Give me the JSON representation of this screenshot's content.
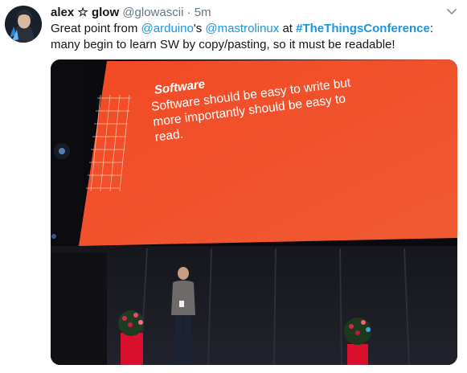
{
  "tweet": {
    "display_name": "alex ☆ glow",
    "handle": "@glowascii",
    "separator": "·",
    "timestamp": "5m",
    "text": {
      "part1": "Great point from ",
      "mention1": "@arduino",
      "part2": "'s ",
      "mention2": "@mastrolinux",
      "part3": " at ",
      "hashtag": "#TheThingsConference",
      "part4": ": many begin to learn SW by copy/pasting, so it must be readable!"
    }
  },
  "photo": {
    "slide_title": "Software",
    "slide_body": "Software should be easy to write but more importantly should be easy to read."
  },
  "icons": {
    "more": "chevron-down-icon",
    "avatar": "avatar"
  },
  "colors": {
    "link": "#1b95e0",
    "muted": "#657786",
    "text": "#14171a",
    "slide": "#f0502a"
  }
}
